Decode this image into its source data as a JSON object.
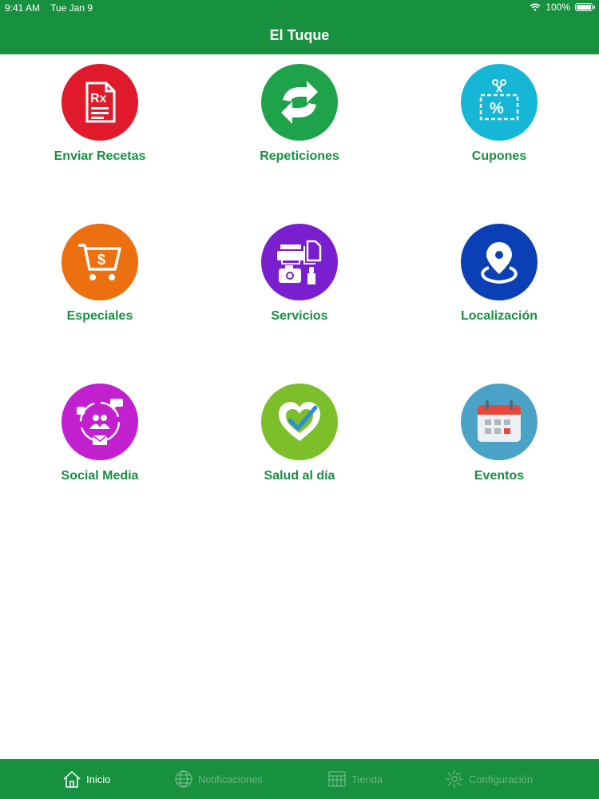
{
  "status": {
    "time": "9:41 AM",
    "date": "Tue Jan 9",
    "battery": "100%",
    "battery_level": 1.0
  },
  "header": {
    "title": "El Tuque"
  },
  "tiles": [
    {
      "label": "Enviar Recetas",
      "icon": "prescription-icon",
      "color": "#e11a2b"
    },
    {
      "label": "Repeticiones",
      "icon": "refresh-icon",
      "color": "#1ea24a"
    },
    {
      "label": "Cupones",
      "icon": "coupon-icon",
      "color": "#16b6d6"
    },
    {
      "label": "Especiales",
      "icon": "shopping-cart-icon",
      "color": "#ec6f10"
    },
    {
      "label": "Servicios",
      "icon": "services-icon",
      "color": "#7a1fd0"
    },
    {
      "label": "Localización",
      "icon": "location-pin-icon",
      "color": "#0b3fb5"
    },
    {
      "label": "Social Media",
      "icon": "social-media-icon",
      "color": "#c21fcf"
    },
    {
      "label": "Salud al día",
      "icon": "health-heart-icon",
      "color": "#7cbf2b"
    },
    {
      "label": "Eventos",
      "icon": "calendar-icon",
      "color": "#4aa3c7"
    }
  ],
  "tabs": [
    {
      "label": "Inicio",
      "icon": "home-icon",
      "active": true
    },
    {
      "label": "Notificaciones",
      "icon": "globe-icon",
      "active": false
    },
    {
      "label": "Tienda",
      "icon": "store-icon",
      "active": false
    },
    {
      "label": "Configuración",
      "icon": "gear-icon",
      "active": false
    }
  ],
  "colors": {
    "primary": "#17903f",
    "label": "#17903f",
    "background": "#ffffff"
  }
}
